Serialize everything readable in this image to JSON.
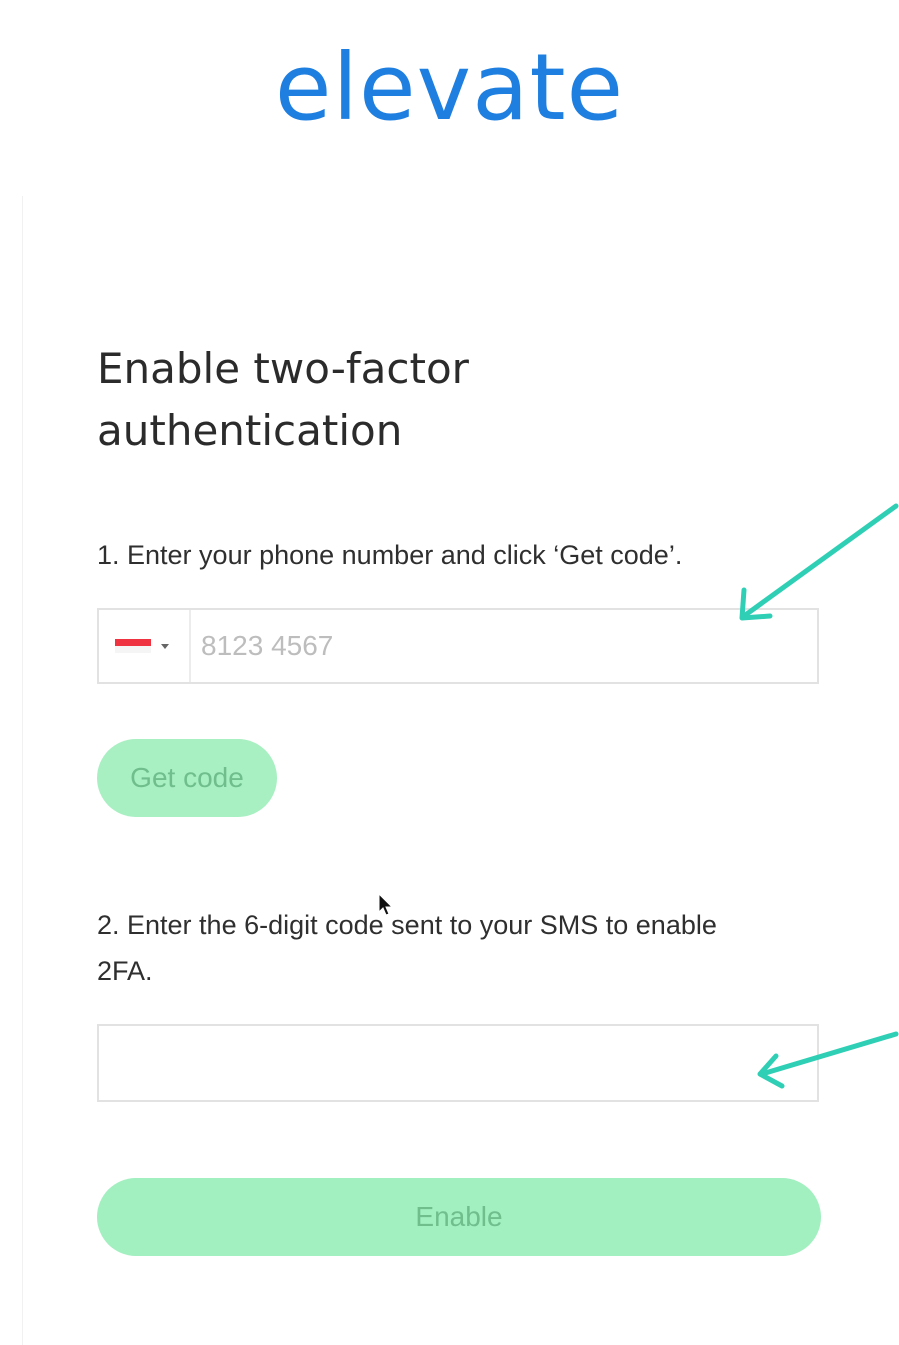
{
  "brand": {
    "logo_text": "elevate",
    "logo_color": "#1f7fe0"
  },
  "card": {
    "title": "Enable two-factor authentication",
    "step1_text": "1. Enter your phone number and click ‘Get code’.",
    "phone": {
      "country_flag": "singapore-flag-icon",
      "placeholder": "8123 4567",
      "value": ""
    },
    "get_code_label": "Get code",
    "step2_text": "2. Enter the 6-digit code sent to your SMS to enable 2FA.",
    "code": {
      "placeholder": "",
      "value": ""
    },
    "enable_label": "Enable"
  },
  "colors": {
    "button_bg": "#a2efc0",
    "button_text": "#6fbe8c",
    "annotation_arrow": "#2fcfb5"
  }
}
